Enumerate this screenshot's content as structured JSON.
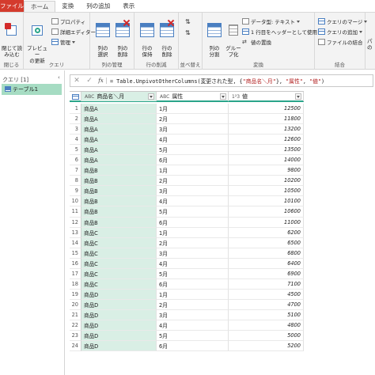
{
  "tabs": [
    "ファイル",
    "ホーム",
    "変換",
    "列の追加",
    "表示"
  ],
  "ribbon": {
    "close_group": {
      "btn": "閉じて読\nみ込む",
      "label": "閉じる"
    },
    "query_group": {
      "preview": "プレビュー\nの更新",
      "properties": "プロパティ",
      "advanced_editor": "詳細エディター",
      "manage": "管理",
      "label": "クエリ"
    },
    "columns_group": {
      "choose": "列の\n選択",
      "remove": "列の\n削除",
      "label": "列の管理"
    },
    "rows_group": {
      "keep": "行の\n保持",
      "remove": "行の\n削除",
      "label": "行の削減"
    },
    "sort_group": {
      "label": "並べ替え"
    },
    "transform_group": {
      "split": "列の\n分割",
      "groupby": "グルー\nプ化",
      "datatype": "データ型: テキスト",
      "header": "1 行目をヘッダーとして使用",
      "replace": "値の置換",
      "label": "変換"
    },
    "combine_group": {
      "merge": "クエリのマージ",
      "append": "クエリの追加",
      "combine": "ファイルの結合",
      "label": "結合"
    },
    "param_group": {
      "btn": "パ\nの"
    }
  },
  "query_pane": {
    "header": "クエリ [1]",
    "item": "テーブル1"
  },
  "formula": {
    "prefix": "= Table.UnpivotOtherColumns(変更された型, {",
    "s1": "\"商品名＼月\"",
    "mid": "}, ",
    "s2": "\"属性\"",
    "sep": ", ",
    "s3": "\"値\"",
    "suffix": ")"
  },
  "columns": [
    {
      "type": "ABC",
      "name": "商品名＼月"
    },
    {
      "type": "ABC",
      "name": "属性"
    },
    {
      "type": "1²3",
      "name": "値"
    }
  ],
  "rows": [
    [
      "1",
      "商品A",
      "1月",
      "12500"
    ],
    [
      "2",
      "商品A",
      "2月",
      "11800"
    ],
    [
      "3",
      "商品A",
      "3月",
      "13200"
    ],
    [
      "4",
      "商品A",
      "4月",
      "12600"
    ],
    [
      "5",
      "商品A",
      "5月",
      "13500"
    ],
    [
      "6",
      "商品A",
      "6月",
      "14000"
    ],
    [
      "7",
      "商品B",
      "1月",
      "9800"
    ],
    [
      "8",
      "商品B",
      "2月",
      "10200"
    ],
    [
      "9",
      "商品B",
      "3月",
      "10500"
    ],
    [
      "10",
      "商品B",
      "4月",
      "10100"
    ],
    [
      "11",
      "商品B",
      "5月",
      "10600"
    ],
    [
      "12",
      "商品B",
      "6月",
      "11000"
    ],
    [
      "13",
      "商品C",
      "1月",
      "6200"
    ],
    [
      "14",
      "商品C",
      "2月",
      "6500"
    ],
    [
      "15",
      "商品C",
      "3月",
      "6800"
    ],
    [
      "16",
      "商品C",
      "4月",
      "6400"
    ],
    [
      "17",
      "商品C",
      "5月",
      "6900"
    ],
    [
      "18",
      "商品C",
      "6月",
      "7100"
    ],
    [
      "19",
      "商品D",
      "1月",
      "4500"
    ],
    [
      "20",
      "商品D",
      "2月",
      "4700"
    ],
    [
      "21",
      "商品D",
      "3月",
      "5100"
    ],
    [
      "22",
      "商品D",
      "4月",
      "4800"
    ],
    [
      "23",
      "商品D",
      "5月",
      "5000"
    ],
    [
      "24",
      "商品D",
      "6月",
      "5200"
    ]
  ]
}
